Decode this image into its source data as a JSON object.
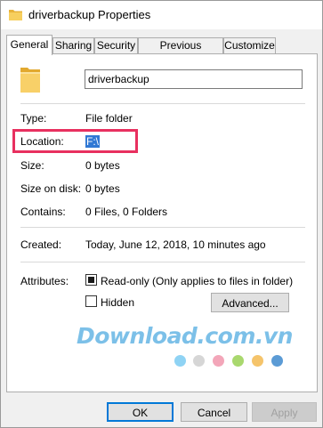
{
  "window": {
    "title": "driverbackup Properties"
  },
  "tabs": [
    {
      "label": "General"
    },
    {
      "label": "Sharing"
    },
    {
      "label": "Security"
    },
    {
      "label": "Previous Versions"
    },
    {
      "label": "Customize"
    }
  ],
  "general": {
    "name_value": "driverbackup",
    "rows": {
      "type": {
        "label": "Type:",
        "value": "File folder"
      },
      "location": {
        "label": "Location:",
        "value": "F:\\"
      },
      "size": {
        "label": "Size:",
        "value": "0 bytes"
      },
      "size_on_disk": {
        "label": "Size on disk:",
        "value": "0 bytes"
      },
      "contains": {
        "label": "Contains:",
        "value": "0 Files, 0 Folders"
      },
      "created": {
        "label": "Created:",
        "value": "Today, June 12, 2018, 10 minutes ago"
      }
    },
    "attributes": {
      "label": "Attributes:",
      "readonly_label": "Read-only (Only applies to files in folder)",
      "readonly_checked": true,
      "hidden_label": "Hidden",
      "hidden_checked": false,
      "advanced_label": "Advanced..."
    }
  },
  "watermark": {
    "text": "Download.com.vn",
    "dot_colors": [
      "#8fd3f4",
      "#d6d6d6",
      "#f3a6b9",
      "#a9d86e",
      "#f5c46b",
      "#5b9bd5",
      "#ef6f6f"
    ]
  },
  "buttons": {
    "ok": "OK",
    "cancel": "Cancel",
    "apply": "Apply"
  },
  "colors": {
    "highlight_border": "#e8305f",
    "selection": "#3078d4",
    "folder": "#f4c55a"
  }
}
